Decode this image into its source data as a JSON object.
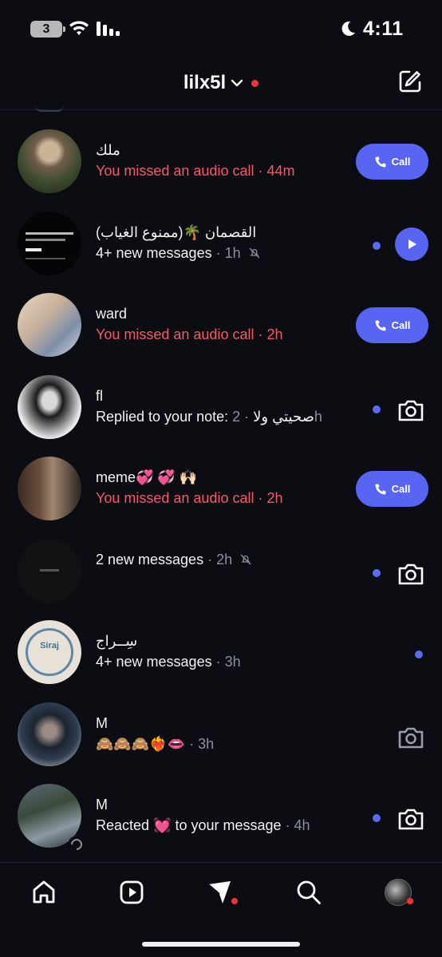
{
  "status_bar": {
    "battery": "3",
    "time": "4:11",
    "icons": [
      "wifi-icon",
      "signal-icon",
      "moon-icon"
    ]
  },
  "header": {
    "account": "lilx5l",
    "icons": [
      "chevron-down-icon",
      "compose-icon"
    ],
    "notification_dot_color": "#f2313b"
  },
  "colors": {
    "accent": "#5865f2",
    "missed": "#f2596a",
    "background": "#0b0d12",
    "muted": "#8d9099"
  },
  "threads": [
    {
      "name": "ملك",
      "message": "You missed an audio call",
      "time": "44m",
      "style": "missed",
      "action": "call",
      "action_label": "Call"
    },
    {
      "name": "القصمان 🌴(ممنوع الغياب)",
      "message": "4+ new messages",
      "time": "1h",
      "style": "normal",
      "muted": true,
      "unread": true,
      "action": "play"
    },
    {
      "name": "ward",
      "message": "You missed an audio call",
      "time": "2h",
      "style": "missed",
      "action": "call",
      "action_label": "Call"
    },
    {
      "name": "fl",
      "message": "Replied to your note: صحيتي ولا",
      "time": "2h",
      "style": "normal",
      "unread": true,
      "action": "camera"
    },
    {
      "name": "meme💞 💞 🙌🏻",
      "message": "You missed an audio call",
      "time": "2h",
      "style": "missed",
      "action": "call",
      "action_label": "Call"
    },
    {
      "name": "",
      "message": "2 new messages",
      "time": "2h",
      "style": "normal",
      "muted": true,
      "unread": true,
      "action": "camera"
    },
    {
      "name": "سِــراج",
      "message": "4+ new messages",
      "time": "3h",
      "style": "normal",
      "unread": true,
      "action": "none"
    },
    {
      "name": "M",
      "message": "🙈🙈🙈❤️‍🔥👄",
      "time": "3h",
      "style": "normal",
      "action": "camera-dim"
    },
    {
      "name": "M",
      "message": "Reacted 💓 to your message",
      "time": "4h",
      "style": "normal",
      "unread": true,
      "action": "camera"
    }
  ],
  "avatar_texts": {
    "siraj": "Siraj"
  },
  "bottom_nav": [
    "home-icon",
    "reels-icon",
    "messages-icon",
    "search-icon",
    "profile-avatar"
  ]
}
